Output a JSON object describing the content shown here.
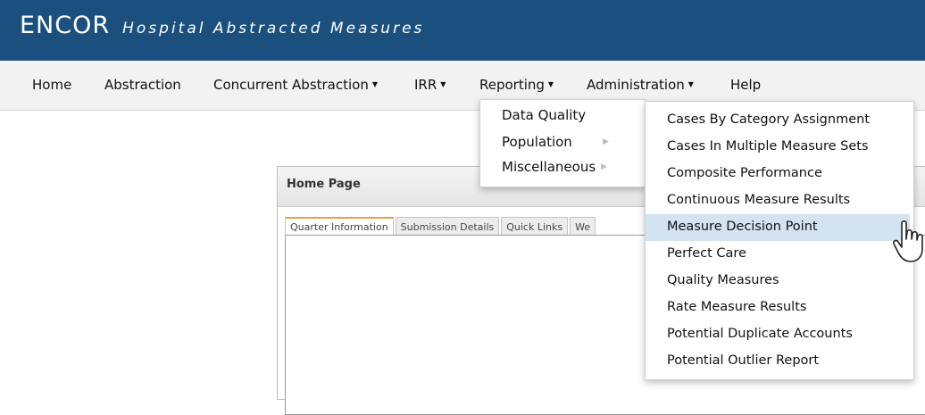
{
  "header": {
    "logo_text": "ENCOR",
    "app_title": "Hospital Abstracted Measures",
    "bg_color": "#1b4f7d"
  },
  "nav": {
    "home": "Home",
    "abstraction": "Abstraction",
    "concurrent": "Concurrent Abstraction",
    "irr": "IRR",
    "reporting": "Reporting",
    "administration": "Administration",
    "help": "Help"
  },
  "reporting_menu": {
    "items": [
      "Data Quality",
      "Population",
      "Miscellaneous"
    ]
  },
  "misc_submenu": {
    "items": [
      "Cases By Category Assignment",
      "Cases In Multiple Measure Sets",
      "Composite Performance",
      "Continuous Measure Results",
      "Measure Decision Point",
      "Perfect Care",
      "Quality Measures",
      "Rate Measure Results",
      "Potential Duplicate Accounts",
      "Potential Outlier Report"
    ],
    "hover_color": "#d3e3f1"
  },
  "home_panel": {
    "title": "Home Page",
    "tabs": [
      "Quarter Information",
      "Submission Details",
      "Quick Links",
      "We"
    ]
  }
}
